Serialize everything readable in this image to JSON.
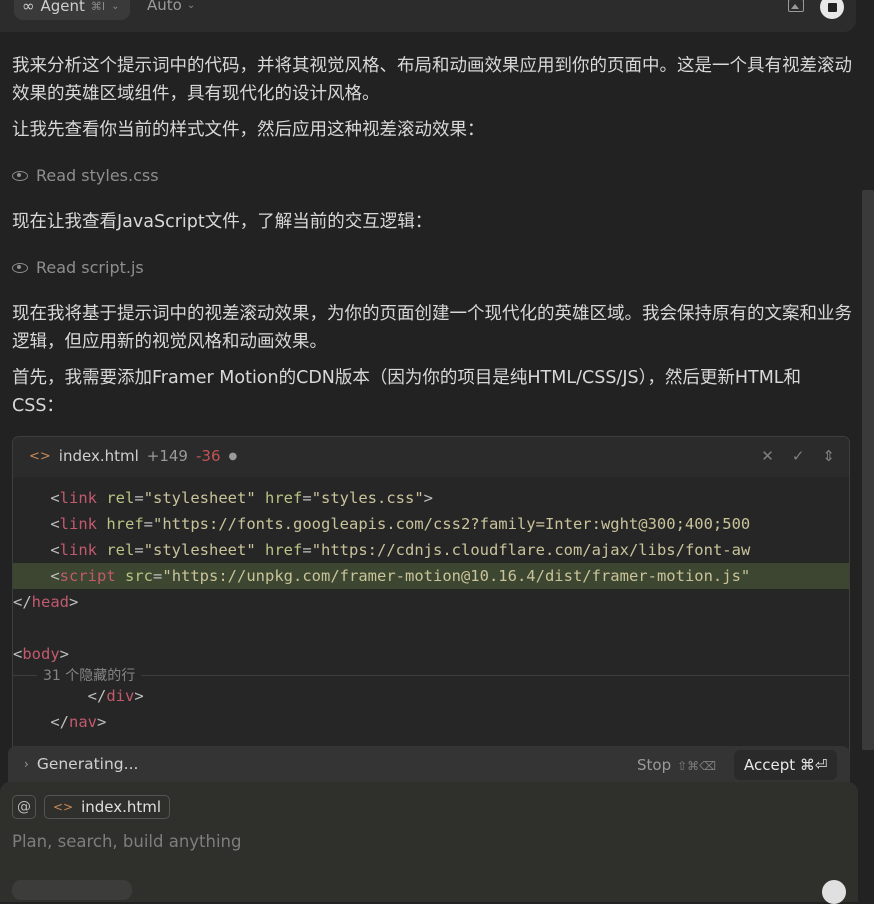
{
  "topbar": {
    "agent_icon": "infinity-icon",
    "agent_label": "Agent",
    "agent_shortcut": "⌘I",
    "model_label": "Auto",
    "image_icon": "image-icon",
    "stop_icon": "stop-icon"
  },
  "messages": {
    "p1": "我来分析这个提示词中的代码，并将其视觉风格、布局和动画效果应用到你的页面中。这是一个具有视差滚动效果的英雄区域组件，具有现代化的设计风格。",
    "p2": "让我先查看你当前的样式文件，然后应用这种视差滚动效果：",
    "tool1": "Read styles.css",
    "p3": "现在让我查看JavaScript文件，了解当前的交互逻辑：",
    "tool2": "Read script.js",
    "p4": "现在我将基于提示词中的视差滚动效果，为你的页面创建一个现代化的英雄区域。我会保持原有的文案和业务逻辑，但应用新的视觉风格和动画效果。",
    "p5": "首先，我需要添加Framer Motion的CDN版本（因为你的项目是纯HTML/CSS/JS），然后更新HTML和CSS："
  },
  "codeblock": {
    "filename": "index.html",
    "additions": "+149",
    "deletions": "-36",
    "hidden_lines": "31 个隐藏的行",
    "lines": {
      "l1_rel": "\"stylesheet\"",
      "l1_href": "\"styles.css\"",
      "l2_href": "\"https://fonts.googleapis.com/css2?family=Inter:wght@300;400;500",
      "l3_rel": "\"stylesheet\"",
      "l3_href": "\"https://cdnjs.cloudflare.com/ajax/libs/font-aw",
      "l4_src": "\"https://unpkg.com/framer-motion@10.16.4/dist/framer-motion.js\""
    }
  },
  "generating": {
    "label": "Generating...",
    "stop_label": "Stop",
    "stop_shortcut": "⇧⌘⌫",
    "accept_label": "Accept ⌘⏎"
  },
  "composer": {
    "at_label": "@",
    "context_file": "index.html",
    "placeholder": "Plan, search, build anything"
  }
}
